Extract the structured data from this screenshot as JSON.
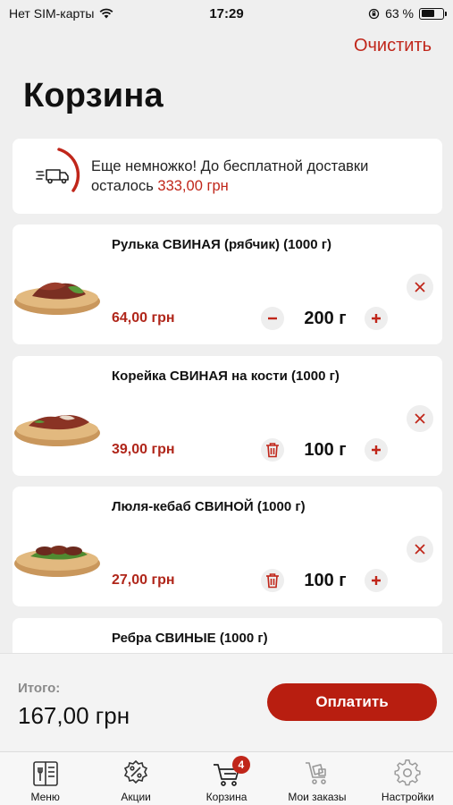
{
  "status_bar": {
    "carrier": "Нет SIM-карты",
    "time": "17:29",
    "battery": "63 %",
    "battery_level": 0.63
  },
  "header": {
    "clear_label": "Очистить",
    "title": "Корзина"
  },
  "delivery": {
    "line1": "Еще немножко! До бесплатной доставки",
    "line2_prefix": "осталось ",
    "amount": "333,00 грн"
  },
  "items": [
    {
      "name": "Рулька СВИНАЯ (рябчик) (1000 г)",
      "price": "64,00 грн",
      "quantity": "200 г",
      "decrement_icon": "minus-icon"
    },
    {
      "name": "Корейка СВИНАЯ на кости  (1000 г)",
      "price": "39,00 грн",
      "quantity": "100 г",
      "decrement_icon": "trash-icon"
    },
    {
      "name": "Люля-кебаб СВИНОЙ  (1000 г)",
      "price": "27,00 грн",
      "quantity": "100 г",
      "decrement_icon": "trash-icon"
    },
    {
      "name": "Ребра СВИНЫЕ  (1000 г)"
    }
  ],
  "summary": {
    "total_label": "Итого:",
    "total_value": "167,00 грн",
    "pay_label": "Оплатить"
  },
  "tabs": [
    {
      "label": "Меню",
      "icon": "menu-book-icon"
    },
    {
      "label": "Акции",
      "icon": "discount-icon"
    },
    {
      "label": "Корзина",
      "icon": "cart-icon",
      "badge": "4",
      "active": true
    },
    {
      "label": "Мои заказы",
      "icon": "orders-cart-icon"
    },
    {
      "label": "Настройки",
      "icon": "gear-icon"
    }
  ],
  "colors": {
    "accent": "#c0261a",
    "pay_button": "#b81e10",
    "background": "#efefef"
  }
}
